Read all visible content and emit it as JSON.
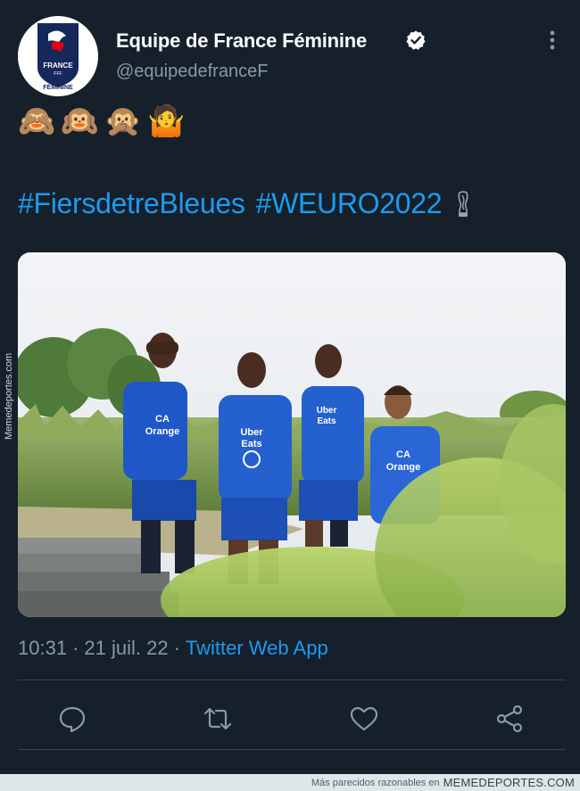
{
  "tweet": {
    "author": {
      "display_name": "Equipe de France Féminine",
      "handle": "@equipedefranceF",
      "verified": true,
      "avatar_text_top": "FRANCE",
      "avatar_text_mid": "FFF",
      "avatar_text_bottom": "FÉMININE"
    },
    "emojis": [
      "🙈",
      "🙉",
      "🙊",
      "🤷"
    ],
    "hashtags": [
      "#FiersdetreBleues",
      "#WEURO2022"
    ],
    "trophy_icon": "trophy-icon",
    "media": {
      "jersey_sponsor_1": "CA",
      "jersey_sponsor_1b": "Orange",
      "jersey_sponsor_2": "Uber",
      "jersey_sponsor_2b": "Eats"
    },
    "time": "10:31",
    "date": "21 juil. 22",
    "separator": "·",
    "source": "Twitter Web App"
  },
  "actions": [
    {
      "name": "reply-icon"
    },
    {
      "name": "retweet-icon"
    },
    {
      "name": "like-icon"
    },
    {
      "name": "share-icon"
    }
  ],
  "watermark": {
    "side_text": "Memedeportes.com",
    "footer_text": "Más parecidos razonables en",
    "footer_brand": "MEMEDEPORTES.COM"
  },
  "colors": {
    "background": "#15202b",
    "accent": "#1d9bf0",
    "muted": "#8b98a5",
    "divider": "#38444d"
  }
}
